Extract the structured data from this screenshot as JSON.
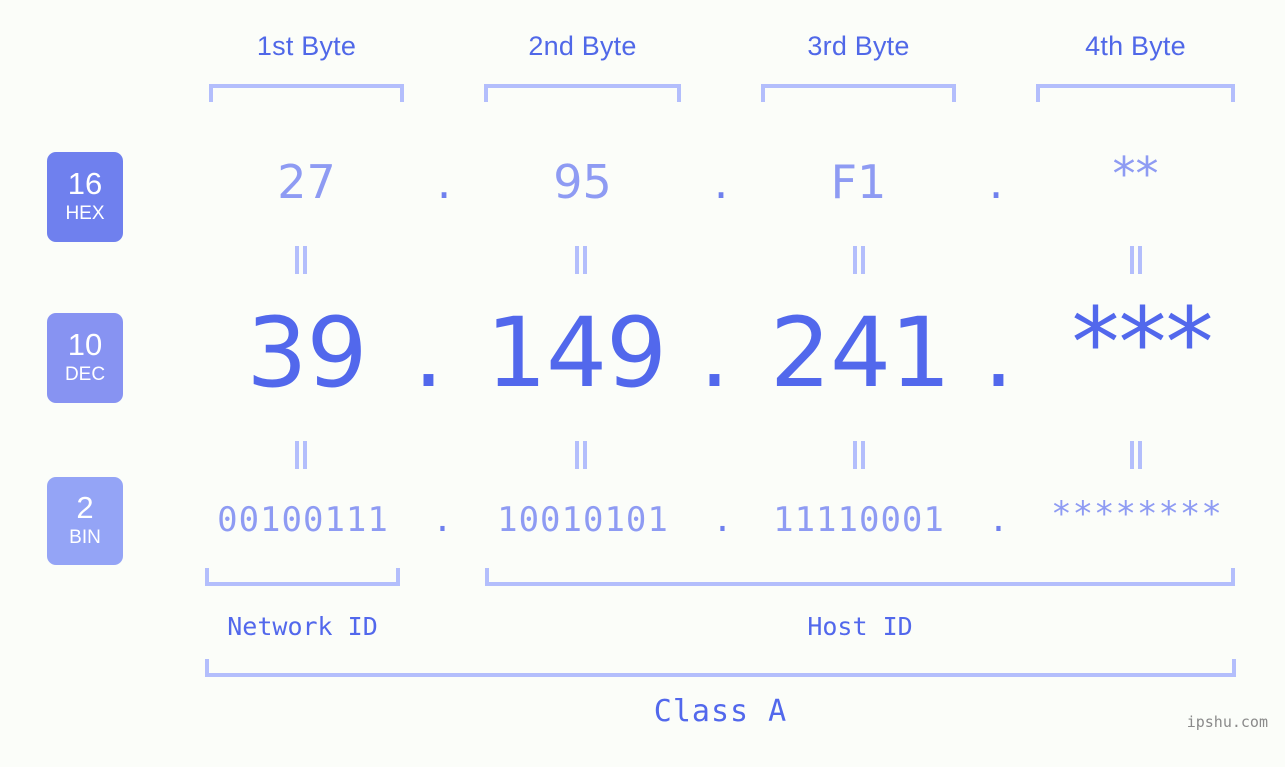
{
  "meta": {
    "site_watermark": "ipshu.com",
    "accent_strong": "#5268ec",
    "accent_mid": "#6f80ee",
    "accent_light": "#8e9bf3",
    "accent_pale": "#b3befc",
    "background": "#fbfdf9"
  },
  "byte_headers": [
    {
      "label": "1st Byte"
    },
    {
      "label": "2nd Byte"
    },
    {
      "label": "3rd Byte"
    },
    {
      "label": "4th Byte"
    }
  ],
  "bases": [
    {
      "number": "16",
      "name": "HEX",
      "color": "#6f80ee"
    },
    {
      "number": "10",
      "name": "DEC",
      "color": "#8793f2"
    },
    {
      "number": "2",
      "name": "BIN",
      "color": "#94a4f6"
    }
  ],
  "rows": {
    "hex": {
      "base_number": "16",
      "base_name": "HEX",
      "values": [
        "27",
        "95",
        "F1",
        "**"
      ],
      "separator": "."
    },
    "dec": {
      "base_number": "10",
      "base_name": "DEC",
      "values": [
        "39",
        "149",
        "241",
        "***"
      ],
      "separator": "."
    },
    "bin": {
      "base_number": "2",
      "base_name": "BIN",
      "values": [
        "00100111",
        "10010101",
        "11110001",
        "********"
      ],
      "separator": "."
    }
  },
  "equals_separators": [
    {
      "symbol": "||"
    },
    {
      "symbol": "||"
    },
    {
      "symbol": "||"
    },
    {
      "symbol": "||"
    },
    {
      "symbol": "||"
    },
    {
      "symbol": "||"
    },
    {
      "symbol": "||"
    },
    {
      "symbol": "||"
    }
  ],
  "id_sections": [
    {
      "label": "Network ID"
    },
    {
      "label": "Host ID"
    }
  ],
  "class": {
    "label": "Class A"
  }
}
